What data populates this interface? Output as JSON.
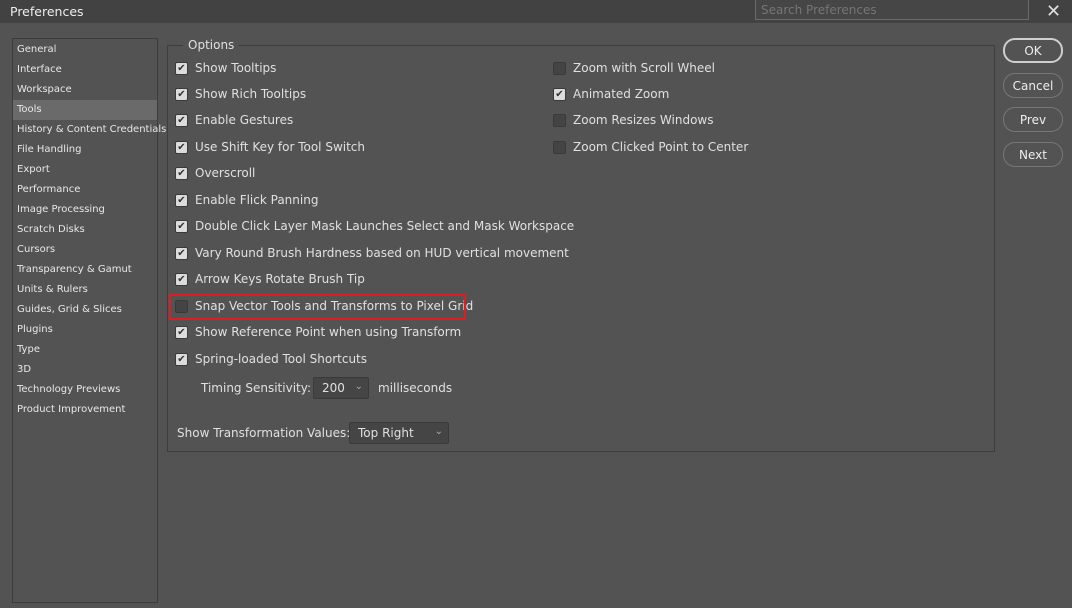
{
  "window": {
    "title": "Preferences",
    "search_placeholder": "Search Preferences",
    "close": "✕"
  },
  "sidebar": {
    "items": [
      "General",
      "Interface",
      "Workspace",
      "Tools",
      "History & Content Credentials",
      "File Handling",
      "Export",
      "Performance",
      "Image Processing",
      "Scratch Disks",
      "Cursors",
      "Transparency & Gamut",
      "Units & Rulers",
      "Guides, Grid & Slices",
      "Plugins",
      "Type",
      "3D",
      "Technology Previews",
      "Product Improvement"
    ],
    "selected": "Tools"
  },
  "options": {
    "label": "Options",
    "left": [
      {
        "label": "Show Tooltips",
        "checked": true
      },
      {
        "label": "Show Rich Tooltips",
        "checked": true
      },
      {
        "label": "Enable Gestures",
        "checked": true
      },
      {
        "label": "Use Shift Key for Tool Switch",
        "checked": true
      },
      {
        "label": "Overscroll",
        "checked": true
      },
      {
        "label": "Enable Flick Panning",
        "checked": true
      },
      {
        "label": "Double Click Layer Mask Launches Select and Mask Workspace",
        "checked": true
      },
      {
        "label": "Vary Round Brush Hardness based on HUD vertical movement",
        "checked": true
      },
      {
        "label": "Arrow Keys Rotate Brush Tip",
        "checked": true
      },
      {
        "label": "Snap Vector Tools and Transforms to Pixel Grid",
        "checked": false
      },
      {
        "label": "Show Reference Point when using Transform",
        "checked": true
      },
      {
        "label": "Spring-loaded Tool Shortcuts",
        "checked": true
      }
    ],
    "right": [
      {
        "label": "Zoom with Scroll Wheel",
        "checked": false
      },
      {
        "label": "Animated Zoom",
        "checked": true
      },
      {
        "label": "Zoom Resizes Windows",
        "checked": false
      },
      {
        "label": "Zoom Clicked Point to Center",
        "checked": false
      }
    ],
    "timing_label": "Timing Sensitivity:",
    "timing_value": "200",
    "timing_unit": "milliseconds",
    "transform_label": "Show Transformation Values:",
    "transform_value": "Top Right"
  },
  "buttons": {
    "ok": "OK",
    "cancel": "Cancel",
    "prev": "Prev",
    "next": "Next"
  },
  "colors": {
    "highlight": "#e01b24"
  }
}
